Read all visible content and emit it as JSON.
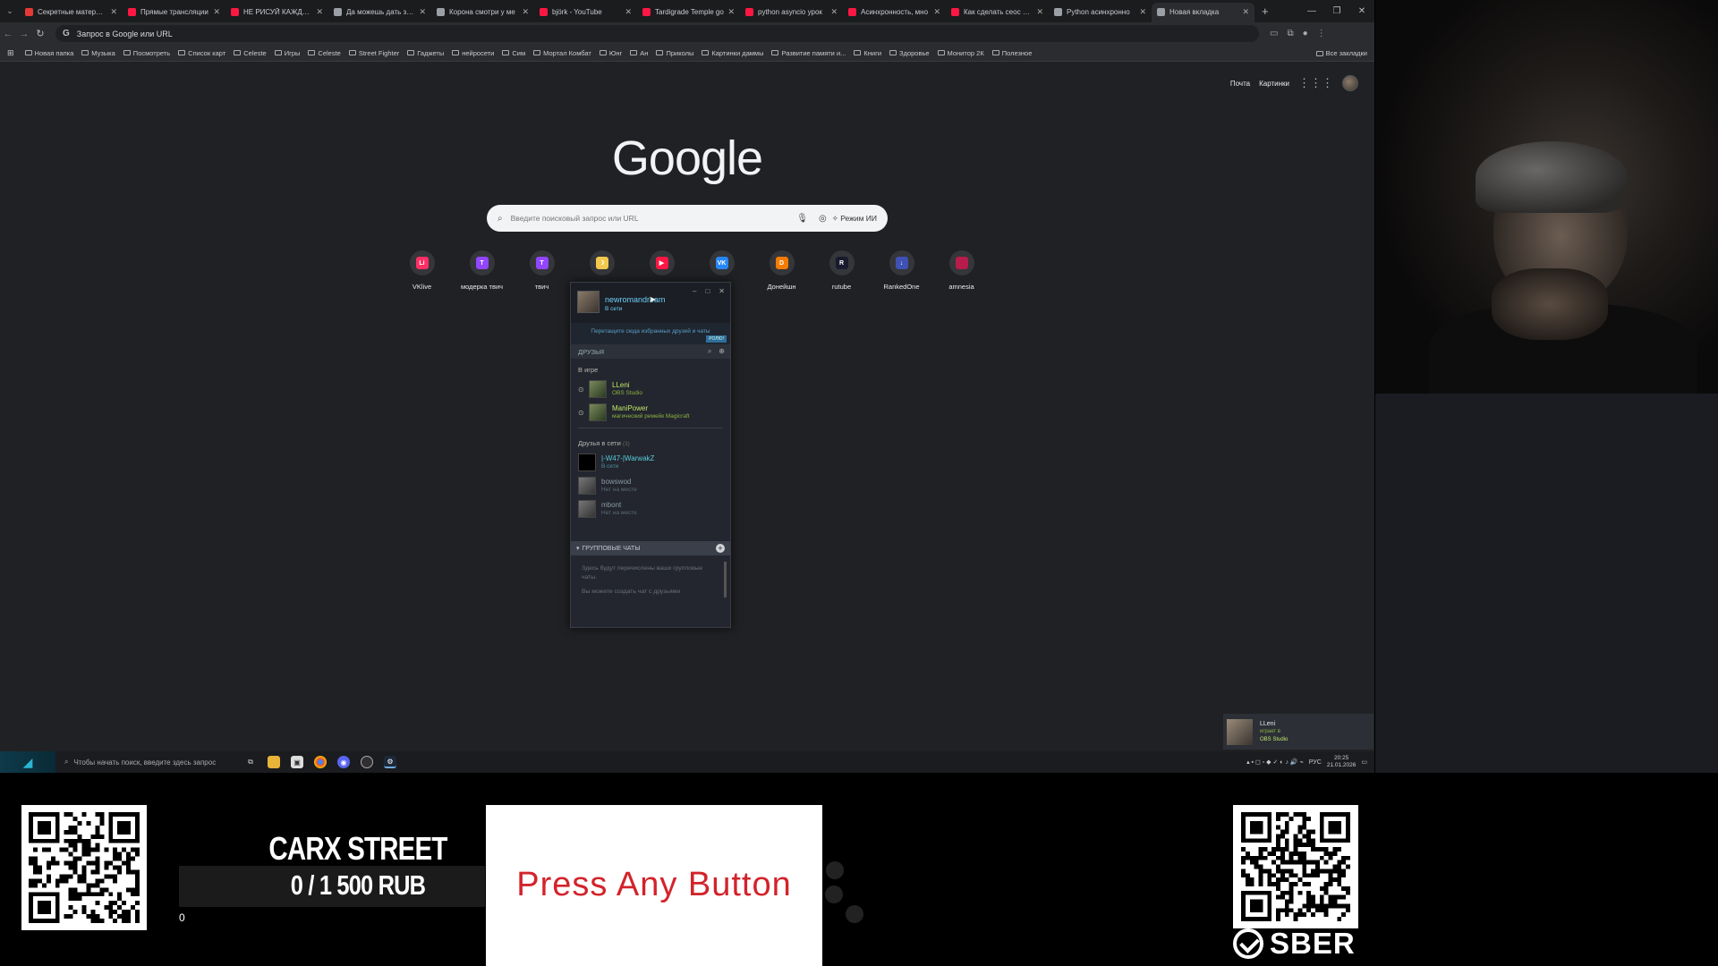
{
  "browser": {
    "tabs": [
      {
        "title": "Секретные материалы",
        "color": "#e53935",
        "active": false
      },
      {
        "title": "Прямые трансляции",
        "color": "#ff1744",
        "active": false
      },
      {
        "title": "НЕ РИСУЙ КАЖДЫЙ",
        "color": "#ff1744",
        "active": false
      },
      {
        "title": "Да можешь дать зада",
        "color": "#9aa0a6",
        "active": false
      },
      {
        "title": "Корона смотри у ме",
        "color": "#9aa0a6",
        "active": false
      },
      {
        "title": "björk - YouTube",
        "color": "#ff1744",
        "active": false
      },
      {
        "title": "Tardigrade Temple go",
        "color": "#ff1744",
        "active": false
      },
      {
        "title": "python asyncio урок",
        "color": "#ff1744",
        "active": false
      },
      {
        "title": "Асинхронность, мно",
        "color": "#ff1744",
        "active": false
      },
      {
        "title": "Как сделать сеос рой",
        "color": "#ff1744",
        "active": false
      },
      {
        "title": "Python асинхронно",
        "color": "#9aa0a6",
        "active": false
      },
      {
        "title": "Новая вкладка",
        "color": "#9aa0a6",
        "active": true
      }
    ],
    "address_placeholder": "Запрос в Google или URL",
    "bookmarks": [
      "Новая папка",
      "Музыка",
      "Посмотреть",
      "Список карт",
      "Celeste",
      "Игры",
      "Celeste",
      "Street Fighter",
      "Гаджеты",
      "нейросети",
      "Сим",
      "Мортал Комбат",
      "Юнг",
      "Ан",
      "Приколы",
      "Картинки даммы",
      "Развитие памяти и...",
      "Книги",
      "Здоровье",
      "Монитор 2К",
      "Полезное"
    ],
    "all_bookmarks": "Все закладки"
  },
  "google": {
    "links": {
      "mail": "Почта",
      "images": "Картинки"
    },
    "logo": "Google",
    "search_placeholder": "Введите поисковый запрос или URL",
    "ai_mode": "Режим ИИ",
    "shortcuts": [
      {
        "label": "VKlive",
        "color": "#ff2e63",
        "glyph": "Li"
      },
      {
        "label": "модерка твич",
        "color": "#9146ff",
        "glyph": "T"
      },
      {
        "label": "твич",
        "color": "#9146ff",
        "glyph": "T"
      },
      {
        "label": "",
        "color": "#f2c94c",
        "glyph": "☽"
      },
      {
        "label": "",
        "color": "#ff1744",
        "glyph": "▶"
      },
      {
        "label": "",
        "color": "#2787f5",
        "glyph": "VK"
      },
      {
        "label": "Донейшн",
        "color": "#f57c00",
        "glyph": "D"
      },
      {
        "label": "rutube",
        "color": "#1a1a2e",
        "glyph": "R"
      },
      {
        "label": "RankedOne",
        "color": "#3f51b5",
        "glyph": "↓"
      },
      {
        "label": "amnesia",
        "color": "#b71c4b",
        "glyph": ""
      }
    ]
  },
  "steam": {
    "username": "newromandream",
    "user_status": "В сети",
    "promo": "Перетащите сюда избранных друзей и чаты",
    "promo_badge": "РОЛЮ!",
    "friends_header": "ДРУЗЬЯ",
    "ingame_header": "В игре",
    "ingame": [
      {
        "name": "LLeni",
        "status": "OBS Studio"
      },
      {
        "name": "ManiPower",
        "status": "магический ремейк Magicraft"
      }
    ],
    "online_header": "Друзья в сети",
    "online_count": "(3)",
    "online": [
      {
        "name": "|-W47-|WarwakZ",
        "status": "В сети",
        "state": "online"
      },
      {
        "name": "bowswod",
        "status": "Нет на месте",
        "state": "offline"
      },
      {
        "name": "mbont",
        "status": "Нет на месте",
        "state": "offline"
      }
    ],
    "groups_header": "ГРУППОВЫЕ ЧАТЫ",
    "groups_text1": "Здесь будут перечислены ваши групповые чаты.",
    "groups_text2": "Вы можете создать чат с друзьями"
  },
  "notification": {
    "name": "LLeni",
    "line2": "играет в",
    "line3": "OBS Studio"
  },
  "taskbar": {
    "search_placeholder": "Чтобы начать поиск, введите здесь запрос",
    "lang": "РУС",
    "time": "20:25",
    "date": "21.01.2026"
  },
  "overlay": {
    "goal_title": "CARX STREET",
    "goal_amount": "0 / 1 500 RUB",
    "goal_progress": 0,
    "goal_zero": "0",
    "press_any_button": "Press Any Button",
    "sber": "SBER"
  }
}
